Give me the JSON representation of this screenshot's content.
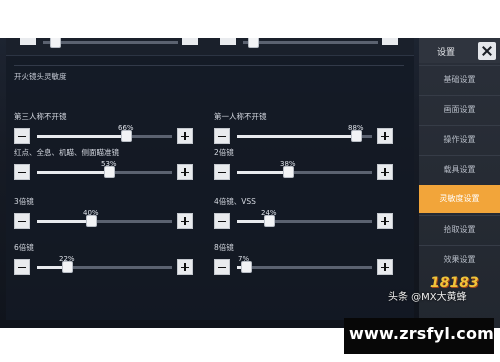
{
  "section": {
    "title": "开火镜头灵敏度"
  },
  "sliders": [
    {
      "label": "第三人称不开镜",
      "value_text": "66%",
      "value": 66
    },
    {
      "label": "第一人称不开镜",
      "value_text": "88%",
      "value": 88
    },
    {
      "label": "红点、全息、机瞄、侧面瞄准镜",
      "value_text": "53%",
      "value": 53
    },
    {
      "label": "2倍镜",
      "value_text": "38%",
      "value": 38
    },
    {
      "label": "3倍镜",
      "value_text": "40%",
      "value": 40
    },
    {
      "label": "4倍镜、VSS",
      "value_text": "24%",
      "value": 24
    },
    {
      "label": "6倍镜",
      "value_text": "22%",
      "value": 22
    },
    {
      "label": "8倍镜",
      "value_text": "7%",
      "value": 7
    }
  ],
  "menu": {
    "title": "设置",
    "items": [
      {
        "label": "基础设置",
        "active": false
      },
      {
        "label": "画面设置",
        "active": false
      },
      {
        "label": "操作设置",
        "active": false
      },
      {
        "label": "载具设置",
        "active": false
      },
      {
        "label": "灵敏度设置",
        "active": true
      },
      {
        "label": "拾取设置",
        "active": false
      },
      {
        "label": "效果设置",
        "active": false
      }
    ]
  },
  "watermark": {
    "author": "头条 @MX大黄蜂",
    "logo": "18183",
    "url": "www.zrsfyl.com"
  },
  "colors": {
    "accent": "#f2a53a",
    "panel": "#1a202b",
    "track": "#5b6270"
  }
}
